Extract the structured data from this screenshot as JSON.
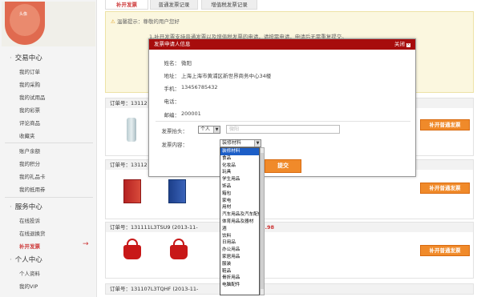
{
  "sidebar": {
    "avatar_caption": "头像",
    "sections": [
      {
        "title": "交易中心",
        "items": [
          "我的订单",
          "我的采购",
          "我的试用品",
          "我的彩票",
          "评论商品",
          "收藏夹",
          "账户余额",
          "我的积分",
          "我的礼品卡",
          "我的抵用券"
        ]
      },
      {
        "title": "服务中心",
        "items": [
          "在线投诉",
          "在线退换货",
          "补开发票"
        ]
      },
      {
        "title": "个人中心",
        "items": [
          "个人资料",
          "我的VIP"
        ]
      }
    ],
    "active_item": "补开发票"
  },
  "tabs": [
    "补开发票",
    "普通发票记录",
    "增值税发票记录"
  ],
  "notice": {
    "title": "温馨提示：",
    "line1": "尊敬的用户您好",
    "line2": "1.补开发票支持普通发票以及增值税发票的申请，请按需申请，申请后无需重复提交。"
  },
  "orders": [
    {
      "label": "订单号：13112",
      "button": "补开普通发票"
    },
    {
      "label": "订单号：13112",
      "button": "补开普通发票"
    },
    {
      "label": "订单号：131111L3TSU9 (2013-11-",
      "price": "3.98",
      "button": "补开普通发票"
    },
    {
      "label": "订单号：131107L3TQHF (2013-11-"
    }
  ],
  "dialog": {
    "title": "发票申请人信息",
    "close_label": "关闭",
    "name_label": "姓名：",
    "name_value": "微阳",
    "address_label": "地址：",
    "address_value": "上海上海市黄浦区新世界商务中心34楼",
    "mobile_label": "手机：",
    "mobile_value": "13456785432",
    "phone_label": "电话：",
    "phone_value": "",
    "zip_label": "邮编：",
    "zip_value": "200001",
    "title_label": "发票抬头：",
    "title_select": "个人",
    "title_input_placeholder": "微阳",
    "content_label": "发票内容：",
    "content_select": "装修材料",
    "submit_label": "提交"
  },
  "dropdown_options": [
    "装修材料",
    "食品",
    "化妆品",
    "玩具",
    "学生用品",
    "饰品",
    "箱包",
    "家电",
    "用材",
    "汽车用品及汽车配件",
    "体育用品及器材",
    "酒",
    "饮料",
    "日用品",
    "办公用品",
    "家居用品",
    "服装",
    "鞋品",
    "骨折用品",
    "电脑配件"
  ],
  "dropdown_selected": "装修材料"
}
